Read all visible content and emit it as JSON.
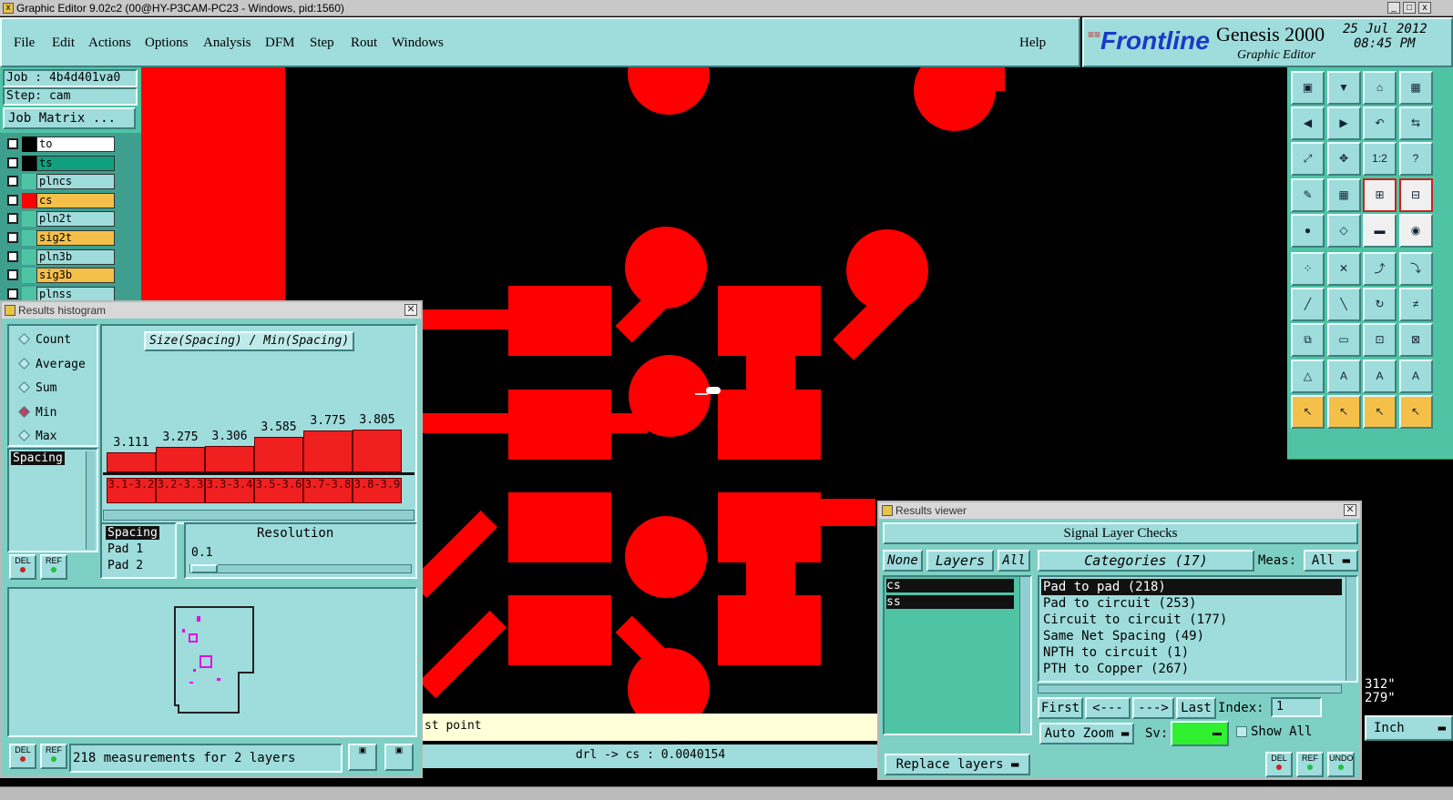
{
  "window": {
    "title": "Graphic Editor 9.02c2 (00@HY-P3CAM-PC23 - Windows, pid:1560)"
  },
  "menu": {
    "items": [
      "File",
      "Edit",
      "Actions",
      "Options",
      "Analysis",
      "DFM",
      "Step",
      "Rout",
      "Windows"
    ],
    "help": "Help"
  },
  "brand": {
    "logo": "Frontline",
    "product": "Genesis 2000",
    "subtitle": "Graphic Editor",
    "date": "25 Jul 2012",
    "time": "08:45 PM"
  },
  "job": {
    "job_label": "Job : 4b4d401va0",
    "step_label": "Step: cam",
    "matrix_button": "Job Matrix ..."
  },
  "layers": [
    {
      "name": "to",
      "color": "#ffffff",
      "swatch": "#000000"
    },
    {
      "name": "ts",
      "color": "#10a080",
      "swatch": "#000000"
    },
    {
      "name": "plncs",
      "color": "#9fdcdc",
      "swatch": "#4fc4a4"
    },
    {
      "name": "cs",
      "color": "#f5c04a",
      "swatch": "#ff0000"
    },
    {
      "name": "pln2t",
      "color": "#9fdcdc",
      "swatch": "#4fc4a4"
    },
    {
      "name": "sig2t",
      "color": "#f5c04a",
      "swatch": "#4fc4a4"
    },
    {
      "name": "pln3b",
      "color": "#9fdcdc",
      "swatch": "#4fc4a4"
    },
    {
      "name": "sig3b",
      "color": "#f5c04a",
      "swatch": "#4fc4a4"
    },
    {
      "name": "plnss",
      "color": "#9fdcdc",
      "swatch": "#4fc4a4"
    }
  ],
  "histogram": {
    "title": "Results histogram",
    "modes": [
      "Count",
      "Average",
      "Sum",
      "Min",
      "Max"
    ],
    "selected_mode": "Min",
    "attribute": "Spacing",
    "chart_title": "Size(Spacing) / Min(Spacing)",
    "resolution_label": "Resolution",
    "resolution_value": "0.1",
    "fields": [
      "Spacing",
      "Pad 1",
      "Pad 2"
    ],
    "status": "218 measurements for 2 layers",
    "del": "DEL",
    "ref": "REF"
  },
  "chart_data": {
    "type": "bar",
    "title": "Size(Spacing) / Min(Spacing)",
    "categories": [
      "3.1-3.2",
      "3.2-3.3",
      "3.3-3.4",
      "3.5-3.6",
      "3.7-3.8",
      "3.8-3.9"
    ],
    "values": [
      3.111,
      3.275,
      3.306,
      3.585,
      3.775,
      3.805
    ],
    "ylim": [
      0,
      4.0
    ]
  },
  "viewer": {
    "title": "Results viewer",
    "header": "Signal Layer Checks",
    "none_btn": "None",
    "layers_btn": "Layers",
    "all_btn": "All",
    "categories_btn": "Categories (17)",
    "meas_label": "Meas:",
    "meas_value": "All",
    "layers": [
      "cs",
      "ss"
    ],
    "categories": [
      "Pad to pad (218)",
      "Pad to circuit (253)",
      "Circuit to circuit (177)",
      "Same Net Spacing (49)",
      "NPTH to circuit (1)",
      "PTH to Copper (267)"
    ],
    "first": "First",
    "prev": "<---",
    "next": "--->",
    "last": "Last",
    "index_label": "Index:",
    "index_value": "1",
    "autozoom": "Auto Zoom",
    "sv_label": "Sv:",
    "show_all": "Show All",
    "replace": "Replace layers",
    "del": "DEL",
    "ref": "REF",
    "undo": "UNDO"
  },
  "status": {
    "prompt": "st point",
    "measure": "drl -> cs : 0.0040154",
    "units": "Inch",
    "coord_x": "312\"",
    "coord_y": "279\""
  },
  "toolbar": {
    "icons": [
      "zoom-home",
      "zoom-in-icon",
      "house-icon",
      "grid-icon",
      "pan-left",
      "pan-right",
      "undo-zoom",
      "redo-icon",
      "fit-icon",
      "center-icon",
      "one-to-one",
      "help-icon",
      "wrench-icon",
      "grid2-icon",
      "netlist-icon",
      "netlist2-icon",
      "pad-icon",
      "outline-icon",
      "ruler-icon",
      "dot-icon",
      "connect-icon",
      "cross-icon",
      "snap-icon",
      "snap2-icon",
      "line-icon",
      "line2-icon",
      "arc-icon",
      "arc2-icon",
      "move-icon",
      "dash-icon",
      "grid3-icon",
      "select-icon",
      "a-icon",
      "a2-icon",
      "a3-icon",
      "a4-icon",
      "pointer-icon",
      "pointer2-icon",
      "pointer3-icon",
      "pointer4-icon"
    ],
    "labels": [
      "1:2",
      "?"
    ]
  }
}
